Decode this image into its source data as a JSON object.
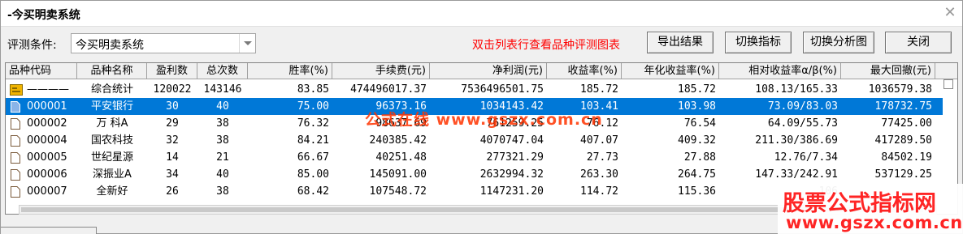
{
  "window": {
    "title": "-今买明卖系统",
    "close_glyph": "✕"
  },
  "toolbar": {
    "condition_label": "评测条件:",
    "condition_value": "今买明卖系统",
    "hint": "双击列表行查看品种评测图表",
    "export_button": "导出结果",
    "switch_indicator_button": "切换指标",
    "switch_chart_button": "切换分析图",
    "close_button": "关闭"
  },
  "table": {
    "headers": [
      "品种代码",
      "品种名称",
      "盈利数",
      "总次数",
      "胜率(%)",
      "手续费(元)",
      "净利润(元)",
      "收益率(%)",
      "年化收益率(%)",
      "相对收益率α/β(%)",
      "最大回撤(元)"
    ],
    "rows": [
      {
        "code": "————",
        "name": "综合统计",
        "wins": "120022",
        "total": "143146",
        "win_rate": "83.85",
        "fee": "474496017.37",
        "net_profit": "7536496501.75",
        "return": "185.72",
        "annual": "185.72",
        "relative": "108.13/165.33",
        "drawdown": "1036579.38",
        "icon": "summary-icon",
        "selected": false
      },
      {
        "code": "000001",
        "name": "平安银行",
        "wins": "30",
        "total": "40",
        "win_rate": "75.00",
        "fee": "96373.16",
        "net_profit": "1034143.42",
        "return": "103.41",
        "annual": "103.98",
        "relative": "73.09/83.03",
        "drawdown": "178732.75",
        "icon": "document-icon",
        "selected": true
      },
      {
        "code": "000002",
        "name": "万 科A",
        "wins": "29",
        "total": "38",
        "win_rate": "76.32",
        "fee": "98637.69",
        "net_profit": "761259.25",
        "return": "76.12",
        "annual": "76.54",
        "relative": "64.09/55.73",
        "drawdown": "77425.00",
        "icon": "document-icon",
        "selected": false
      },
      {
        "code": "000004",
        "name": "国农科技",
        "wins": "32",
        "total": "38",
        "win_rate": "84.21",
        "fee": "240385.42",
        "net_profit": "4070747.04",
        "return": "407.07",
        "annual": "409.32",
        "relative": "211.30/386.69",
        "drawdown": "417289.50",
        "icon": "document-icon",
        "selected": false
      },
      {
        "code": "000005",
        "name": "世纪星源",
        "wins": "14",
        "total": "21",
        "win_rate": "66.67",
        "fee": "40251.48",
        "net_profit": "277321.29",
        "return": "27.73",
        "annual": "27.88",
        "relative": "12.76/7.34",
        "drawdown": "84502.19",
        "icon": "document-icon",
        "selected": false
      },
      {
        "code": "000006",
        "name": "深振业A",
        "wins": "34",
        "total": "40",
        "win_rate": "85.00",
        "fee": "145091.00",
        "net_profit": "2632994.32",
        "return": "263.30",
        "annual": "264.75",
        "relative": "147.33/242.91",
        "drawdown": "537129.25",
        "icon": "document-icon",
        "selected": false
      },
      {
        "code": "000007",
        "name": "全新好",
        "wins": "26",
        "total": "38",
        "win_rate": "68.42",
        "fee": "107548.72",
        "net_profit": "1147231.20",
        "return": "114.72",
        "annual": "115.36",
        "relative": "106",
        "drawdown": "",
        "icon": "document-icon",
        "selected": false
      }
    ]
  },
  "watermarks": {
    "middle": "公式在线 www.gszx.com.cn",
    "badge_line1": "股票公式指标网",
    "badge_line2": "www.gszx.com.cn"
  },
  "colors": {
    "selection": "#0078d7",
    "hint": "#ff0000",
    "watermark": "#ff3300",
    "summary_icon": "#f0b400",
    "document_icon_selected": "#8ab4e8",
    "document_icon": "#7a5a3a"
  }
}
